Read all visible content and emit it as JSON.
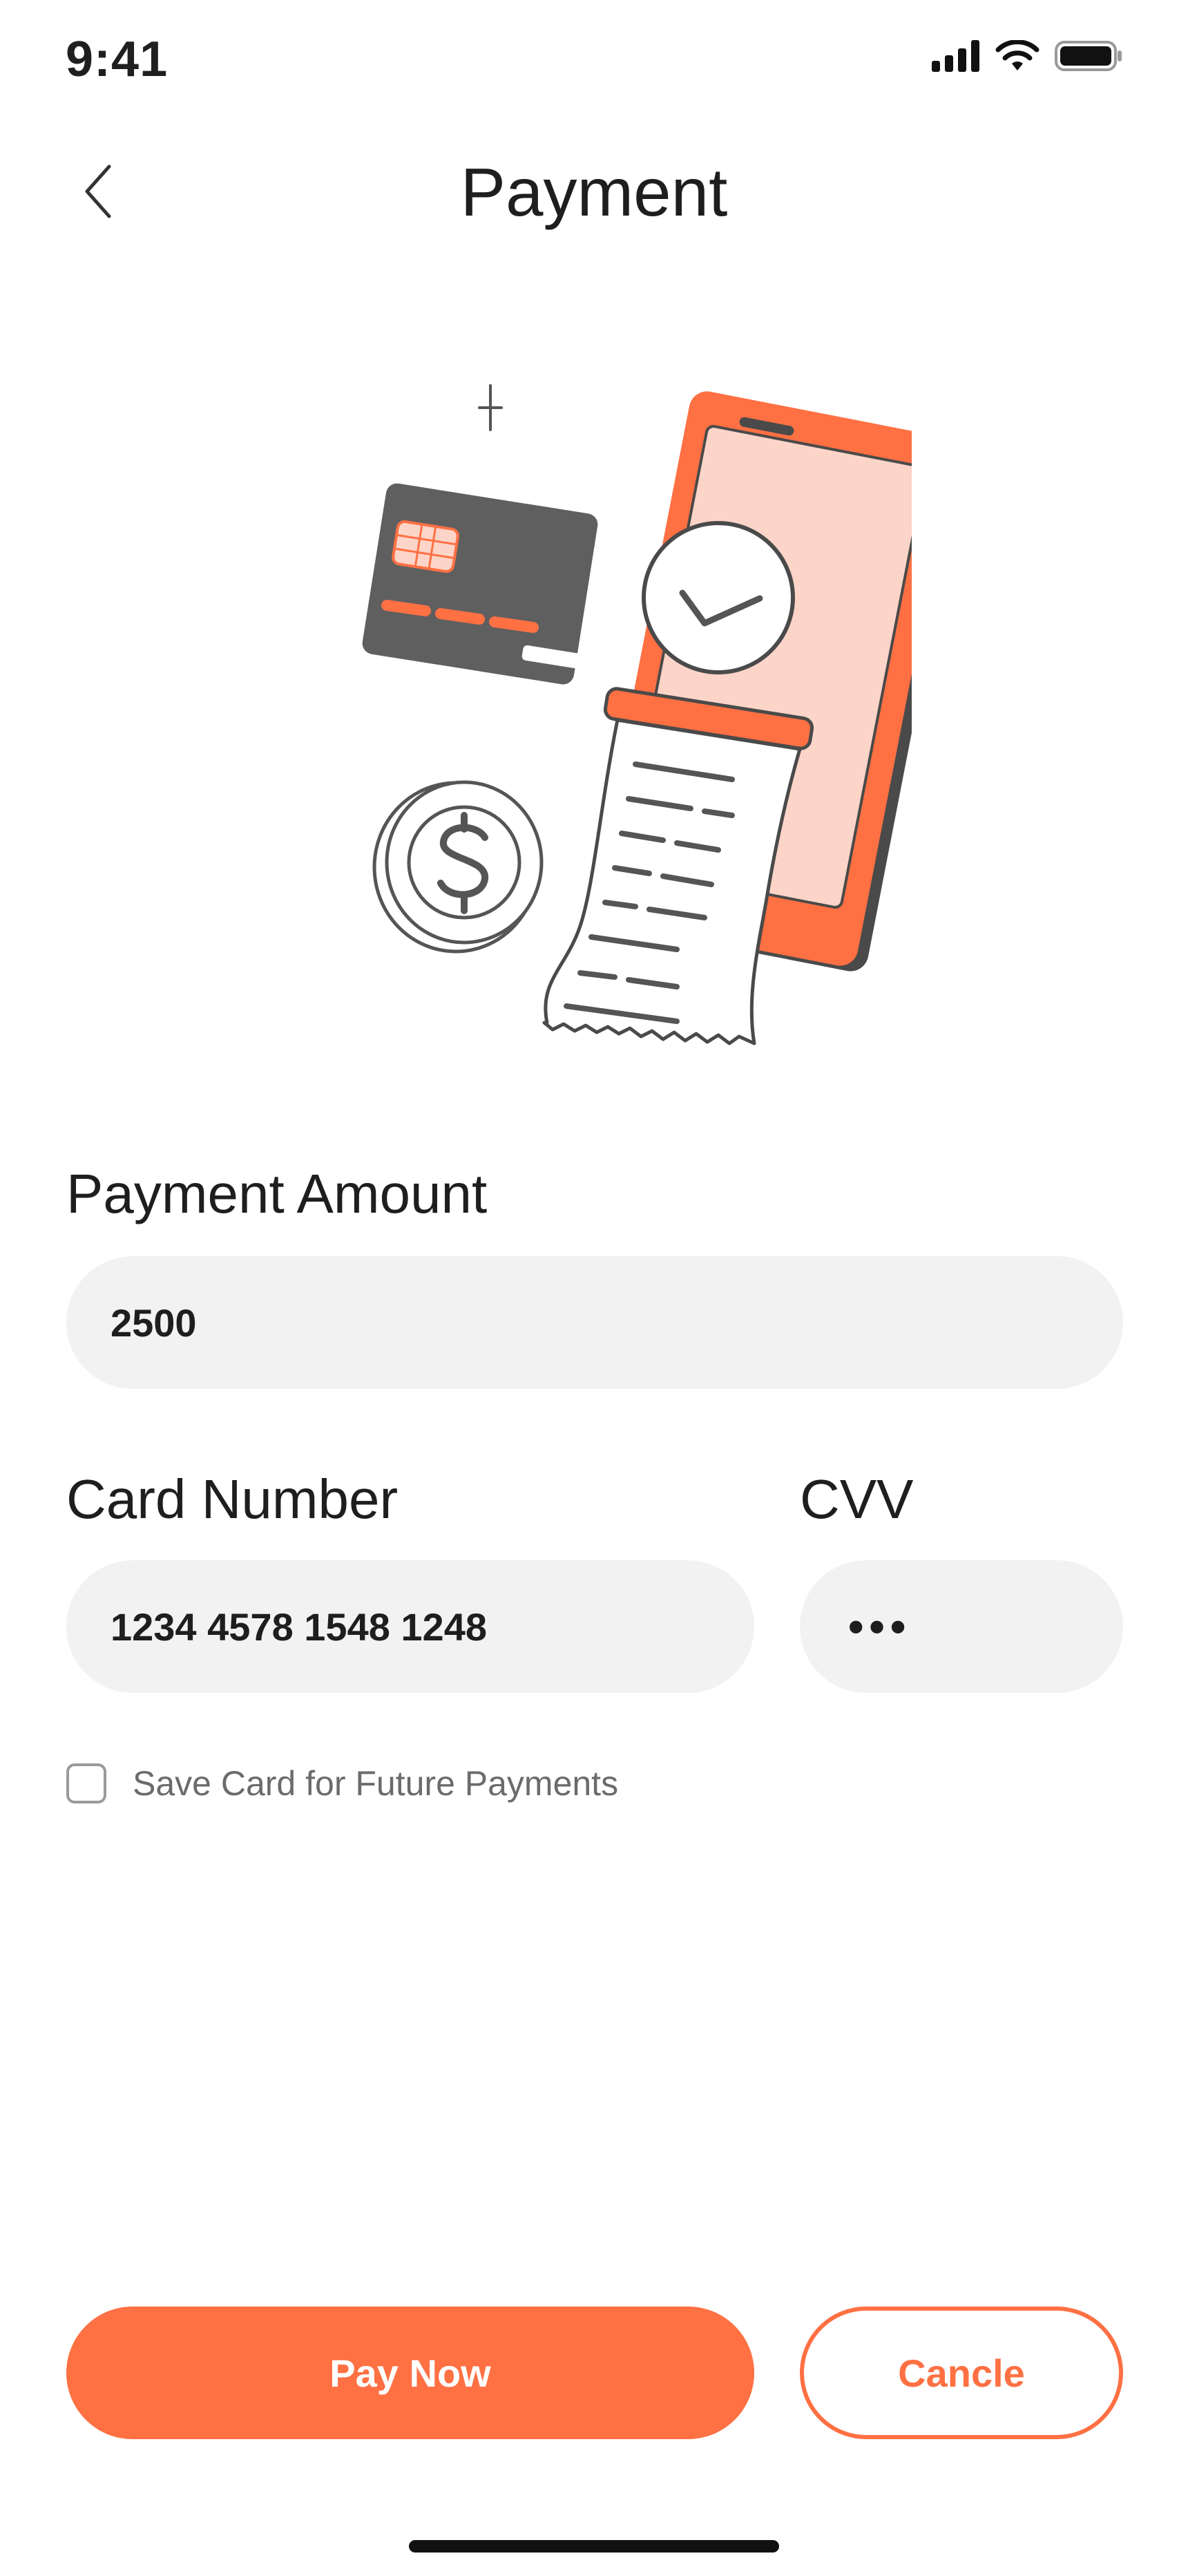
{
  "status_bar": {
    "time": "9:41",
    "icons": [
      "signal-icon",
      "wifi-icon",
      "battery-icon"
    ]
  },
  "header": {
    "title": "Payment",
    "back_icon": "chevron-left-icon"
  },
  "illustration": {
    "name": "payment-illustration",
    "colors": {
      "accent": "#FF7043",
      "accent_light": "#FDD5C8",
      "dark": "#5F5F5F",
      "outline": "#4A4A4A"
    }
  },
  "form": {
    "payment_amount": {
      "label": "Payment Amount",
      "value": "2500"
    },
    "card_number": {
      "label": "Card Number",
      "value": "1234 4578 1548 1248"
    },
    "cvv": {
      "label": "CVV",
      "value": "•••"
    },
    "save_card": {
      "label": "Save Card for Future Payments",
      "checked": false
    }
  },
  "actions": {
    "pay_label": "Pay Now",
    "cancel_label": "Cancle"
  },
  "colors": {
    "accent": "#FF7043",
    "input_bg": "#F2F2F2",
    "text": "#1E1E1E",
    "muted": "#6B6B6B"
  }
}
